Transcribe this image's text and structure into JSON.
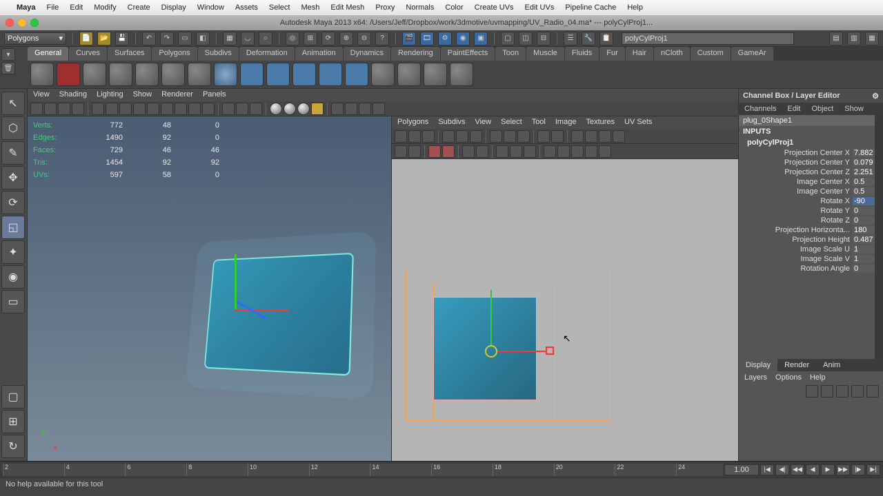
{
  "menubar": {
    "apple": "",
    "app": "Maya",
    "items": [
      "File",
      "Edit",
      "Modify",
      "Create",
      "Display",
      "Window",
      "Assets",
      "Select",
      "Mesh",
      "Edit Mesh",
      "Proxy",
      "Normals",
      "Color",
      "Create UVs",
      "Edit UVs",
      "Pipeline Cache",
      "Help"
    ]
  },
  "titlebar": {
    "document": "Autodesk Maya 2013 x64: /Users/Jeff/Dropbox/work/3dmotive/uvmapping/UV_Radio_04.ma* --- polyCylProj1..."
  },
  "moduleDropdown": "Polygons",
  "nameField": "polyCylProj1",
  "shelfTabs": [
    "General",
    "Curves",
    "Surfaces",
    "Polygons",
    "Subdivs",
    "Deformation",
    "Animation",
    "Dynamics",
    "Rendering",
    "PaintEffects",
    "Toon",
    "Muscle",
    "Fluids",
    "Fur",
    "Hair",
    "nCloth",
    "Custom",
    "GameAr"
  ],
  "shelfActive": "General",
  "viewportMenu": [
    "View",
    "Shading",
    "Lighting",
    "Show",
    "Renderer",
    "Panels"
  ],
  "hud": {
    "rows": [
      {
        "label": "Verts:",
        "a": "772",
        "b": "48",
        "c": "0"
      },
      {
        "label": "Edges:",
        "a": "1490",
        "b": "92",
        "c": "0"
      },
      {
        "label": "Faces:",
        "a": "729",
        "b": "46",
        "c": "46"
      },
      {
        "label": "Tris:",
        "a": "1454",
        "b": "92",
        "c": "92"
      },
      {
        "label": "UVs:",
        "a": "597",
        "b": "58",
        "c": "0"
      }
    ]
  },
  "uvMenu": [
    "Polygons",
    "Subdivs",
    "View",
    "Select",
    "Tool",
    "Image",
    "Textures",
    "UV Sets"
  ],
  "channelBox": {
    "title": "Channel Box / Layer Editor",
    "tabs": [
      "Channels",
      "Edit",
      "Object",
      "Show"
    ],
    "shape": "plug_0Shape1",
    "inputsLabel": "INPUTS",
    "node": "polyCylProj1",
    "attrs": [
      {
        "l": "Projection Center X",
        "v": "7.882"
      },
      {
        "l": "Projection Center Y",
        "v": "0.079"
      },
      {
        "l": "Projection Center Z",
        "v": "2.251"
      },
      {
        "l": "Image Center X",
        "v": "0.5"
      },
      {
        "l": "Image Center Y",
        "v": "0.5"
      },
      {
        "l": "Rotate X",
        "v": "-90",
        "sel": true
      },
      {
        "l": "Rotate Y",
        "v": "0"
      },
      {
        "l": "Rotate Z",
        "v": "0"
      },
      {
        "l": "Projection Horizonta...",
        "v": "180"
      },
      {
        "l": "Projection Height",
        "v": "0.487"
      },
      {
        "l": "Image Scale U",
        "v": "1"
      },
      {
        "l": "Image Scale V",
        "v": "1"
      },
      {
        "l": "Rotation Angle",
        "v": "0"
      }
    ],
    "lowerTabs": [
      "Display",
      "Render",
      "Anim"
    ],
    "lowerActive": "Display",
    "layersMenu": [
      "Layers",
      "Options",
      "Help"
    ]
  },
  "timeline": {
    "ticks": [
      2,
      4,
      6,
      8,
      10,
      12,
      14,
      16,
      18,
      20,
      22,
      24
    ],
    "current": "1.00"
  },
  "helpline": "No help available for this tool"
}
